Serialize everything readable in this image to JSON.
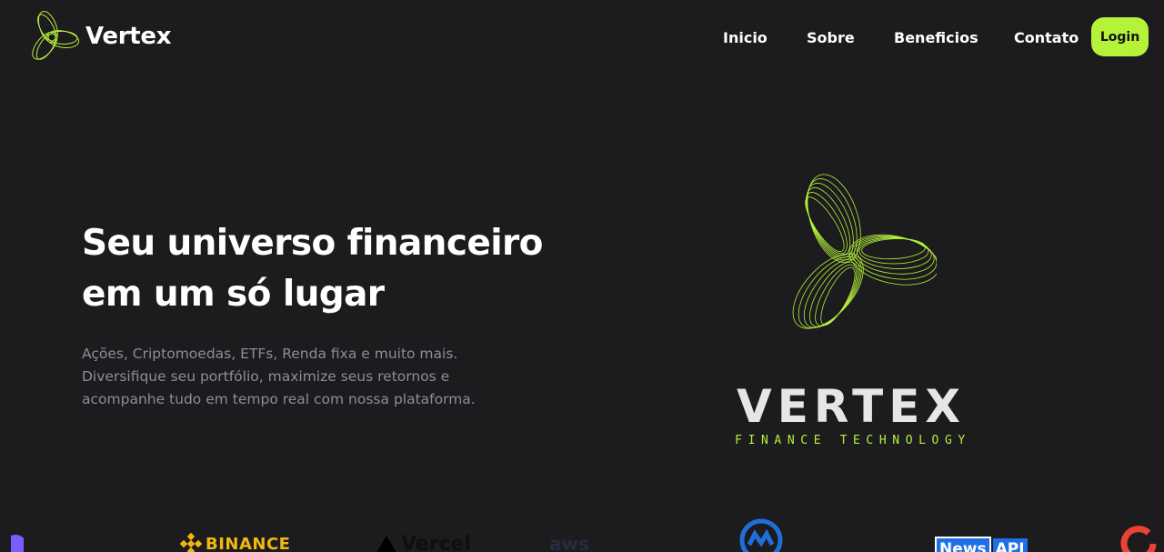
{
  "brand": {
    "name": "Vertex",
    "logo_icon": "vertex-swirl-logo-icon"
  },
  "nav": {
    "links": [
      {
        "label": "Inicio"
      },
      {
        "label": "Sobre"
      },
      {
        "label": "Beneficios"
      },
      {
        "label": "Contato"
      }
    ],
    "login_label": "Login"
  },
  "hero": {
    "title_line1": "Seu universo financeiro",
    "title_line2": "em um só lugar",
    "desc_line1": "Ações, Criptomoedas, ETFs, Renda fixa e muito mais.",
    "desc_line2": "Diversifique seu portfólio, maximize seus retornos e",
    "desc_line3": "acompanhe tudo em tempo real com nossa plataforma.",
    "art_icon": "vertex-swirl-illustration-icon",
    "wordmark": "VERTEX",
    "wordmark_sub": "FINANCE TECHNOLOGY"
  },
  "partners": {
    "binance": "BINANCE",
    "vercel": "Vercel",
    "aws": "aws",
    "newsapi_a": "News",
    "newsapi_b": "API"
  },
  "colors": {
    "background": "#1c1b1e",
    "accent": "#b5f23a",
    "text": "#ffffff",
    "muted": "#8e8e93"
  }
}
